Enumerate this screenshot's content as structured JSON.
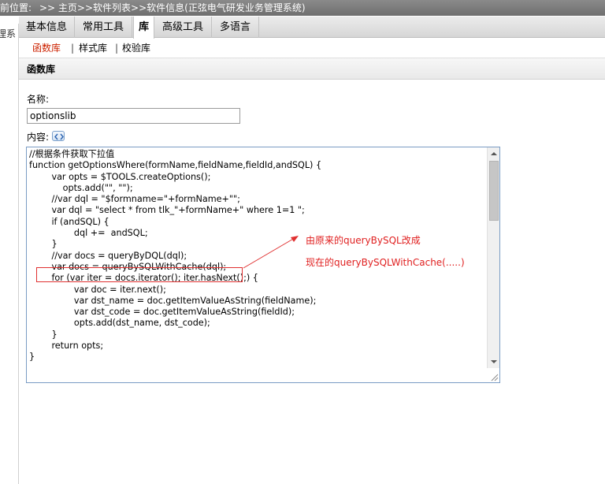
{
  "breadcrumb": {
    "label": "前位置:",
    "path": ">> 主页>>软件列表>>软件信息(正弦电气研发业务管理系统)"
  },
  "left_fragment": "理系",
  "tabs": [
    {
      "label": "基本信息",
      "active": false
    },
    {
      "label": "常用工具",
      "active": false
    },
    {
      "label": "库",
      "active": true
    },
    {
      "label": "高级工具",
      "active": false
    },
    {
      "label": "多语言",
      "active": false
    }
  ],
  "subtabs": {
    "items": [
      "函数库",
      "样式库",
      "校验库"
    ],
    "separator": "|",
    "active": "函数库"
  },
  "section": {
    "title": "函数库"
  },
  "form": {
    "name_label": "名称:",
    "name_value": "optionslib",
    "content_label": "内容:"
  },
  "code_lines": [
    "//根据条件获取下拉值",
    "function getOptionsWhere(formName,fieldName,fieldId,andSQL) {",
    "        var opts = $TOOLS.createOptions();",
    "            opts.add(\"\", \"\");",
    "        //var dql = \"$formname=\"+formName+\"\";",
    "        var dql = \"select * from tlk_\"+formName+\" where 1=1 \";",
    "        if (andSQL) {",
    "                dql +=  andSQL;",
    "        }",
    "        //var docs = queryByDQL(dql);",
    "        var docs = queryBySQLWithCache(dql);",
    "        for (var iter = docs.iterator(); iter.hasNext();) {",
    "                var doc = iter.next();",
    "                var dst_name = doc.getItemValueAsString(fieldName);",
    "                var dst_code = doc.getItemValueAsString(fieldId);",
    "                opts.add(dst_name, dst_code);",
    "        }",
    "        return opts;",
    "}"
  ],
  "annotation": {
    "line1": "由原来的queryBySQL改成",
    "line2": "现在的queryBySQLWithCache(.....)",
    "color": "#e02020"
  },
  "colors": {
    "active_subtab": "#cc2200",
    "editor_border": "#7a9cc4",
    "topbar": "#7c7c7c"
  }
}
